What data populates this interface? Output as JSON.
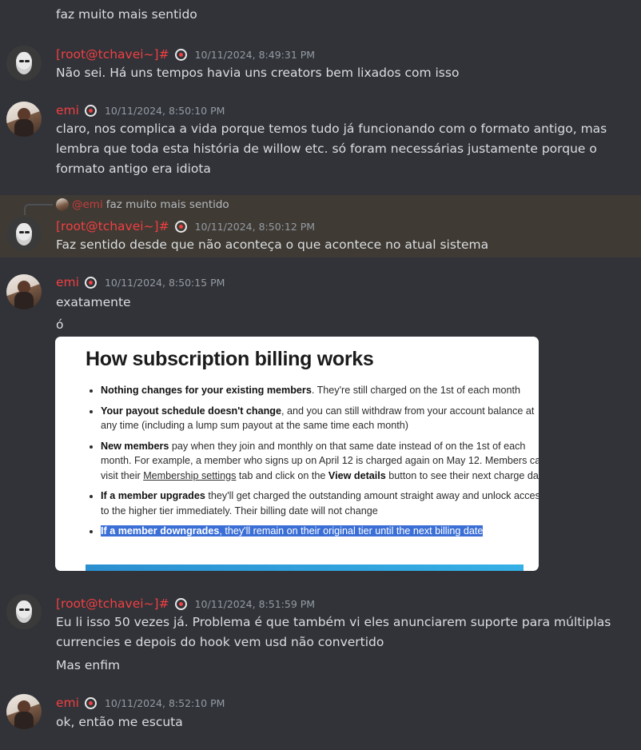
{
  "messages": [
    {
      "text": "faz muito mais sentido"
    },
    {
      "author": "[root@tchavei~]#",
      "timestamp": "10/11/2024, 8:49:31 PM",
      "lines": [
        "Não sei. Há uns tempos havia uns creators bem lixados com isso"
      ]
    },
    {
      "author": "emi",
      "timestamp": "10/11/2024, 8:50:10 PM",
      "lines": [
        "claro, nos complica a vida porque temos tudo já funcionando com o formato antigo, mas",
        "lembra que toda esta história de willow etc. só foram necessárias justamente porque o",
        "formato antigo era idiota"
      ]
    },
    {
      "author": "[root@tchavei~]#",
      "timestamp": "10/11/2024, 8:50:12 PM",
      "reply": {
        "mention": "@emi",
        "text": "faz muito mais sentido"
      },
      "lines": [
        "Faz sentido desde que não aconteça o que acontece no atual sistema"
      ]
    },
    {
      "author": "emi",
      "timestamp": "10/11/2024, 8:50:15 PM",
      "lines": [
        "exatamente",
        "ó"
      ]
    },
    {
      "author": "[root@tchavei~]#",
      "timestamp": "10/11/2024, 8:51:59 PM",
      "lines": [
        "Eu li isso 50 vezes já. Problema é que também vi eles anunciarem suporte para múltiplas",
        "currencies e depois do hook vem usd não convertido",
        "Mas enfim"
      ]
    },
    {
      "author": "emi",
      "timestamp": "10/11/2024, 8:52:10 PM",
      "lines": [
        "ok, então me escuta"
      ]
    }
  ],
  "embed": {
    "title": "How subscription billing works",
    "b1_bold": "Nothing changes for your existing members",
    "b1_rest": ". They're still charged on the 1st of each month",
    "b2_bold": "Your payout schedule doesn't change",
    "b2_rest": ", and you can still withdraw from your account balance at any time (including a lump sum payout at the same time each month)",
    "b3_bold": "New members",
    "b3_rest1": " pay when they join and monthly on that same date instead of on the 1st of each month. For example, a member who signs up on April 12 is charged again on May 12. Members can visit their ",
    "b3_link": "Membership settings",
    "b3_rest2": " tab and click on the ",
    "b3_bold2": "View details",
    "b3_rest3": " button to see their next charge date",
    "b4_bold": "If a member upgrades",
    "b4_rest": " they'll get charged the outstanding amount straight away and unlock access to the higher tier immediately. Their billing date will not change",
    "b5_bold": "If a member downgrades",
    "b5_rest": ", they'll remain on their original tier until the next billing date"
  },
  "colors": {
    "background": "#313338",
    "username": "#f23f42",
    "highlight": "#3f3a33"
  },
  "icons": [
    "avatar-root",
    "avatar-emi",
    "pokeball-badge-icon"
  ]
}
